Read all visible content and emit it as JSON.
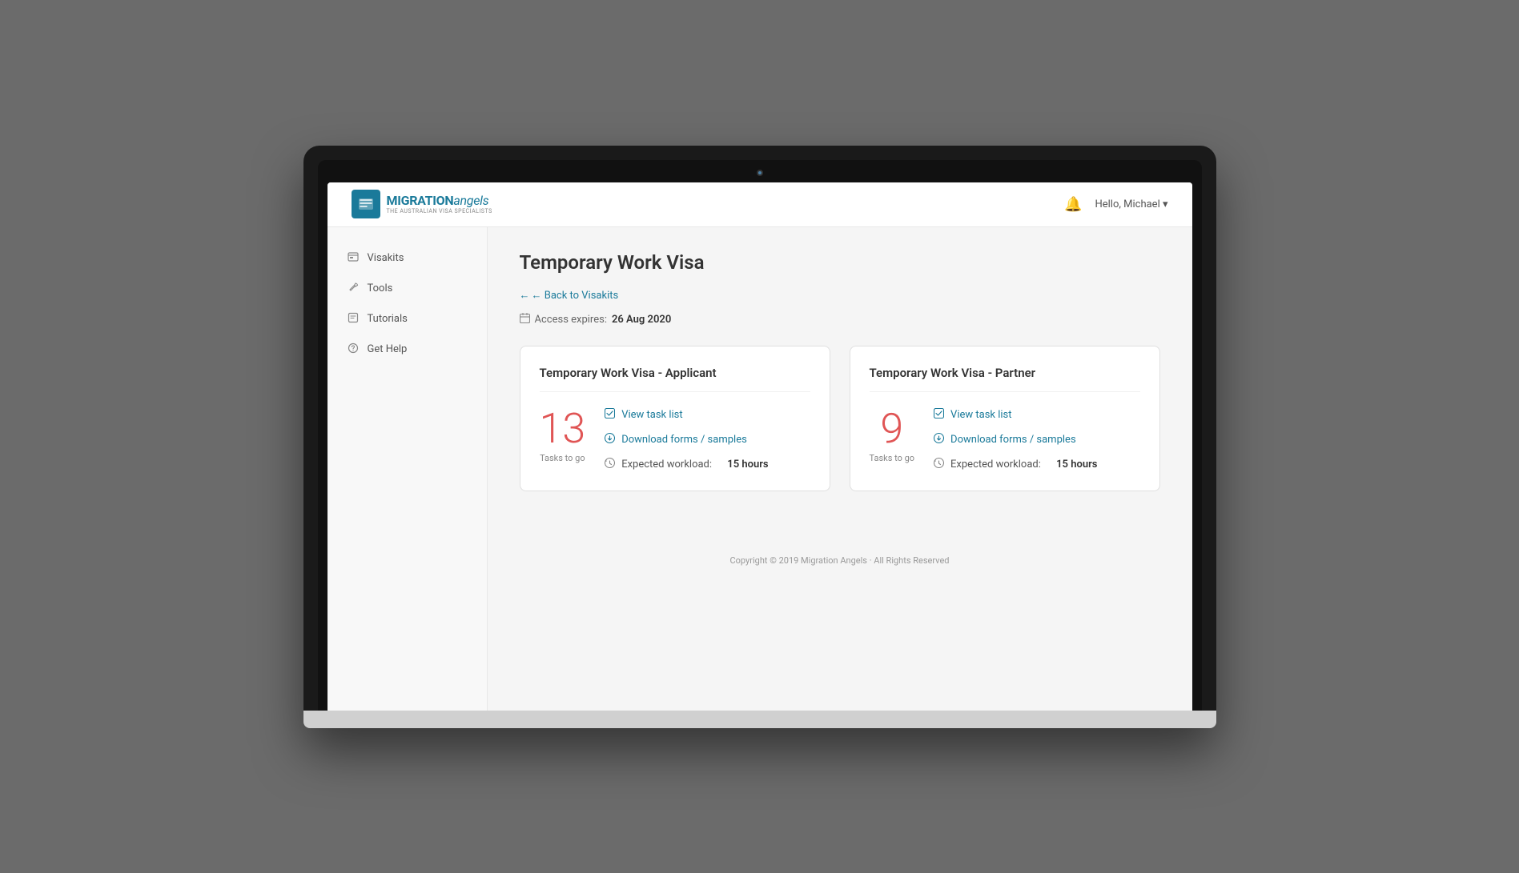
{
  "header": {
    "logo_main": "MIGRATION",
    "logo_accent": "angels",
    "logo_subtitle": "THE AUSTRALIAN VISA SPECIALISTS",
    "greeting": "Hello, Michael ▾"
  },
  "sidebar": {
    "items": [
      {
        "id": "visakits",
        "label": "Visakits",
        "icon": "🪪"
      },
      {
        "id": "tools",
        "label": "Tools",
        "icon": "🔑"
      },
      {
        "id": "tutorials",
        "label": "Tutorials",
        "icon": "📋"
      },
      {
        "id": "gethelp",
        "label": "Get Help",
        "icon": "❓"
      }
    ]
  },
  "main": {
    "page_title": "Temporary Work Visa",
    "back_link": "← Back to Visakits",
    "access_expires_label": "Access expires:",
    "access_expires_date": "26 Aug 2020",
    "applicant_card": {
      "title": "Temporary Work Visa - Applicant",
      "tasks_count": "13",
      "tasks_label": "Tasks to go",
      "view_task_list": "View task list",
      "download_forms": "Download forms / samples",
      "workload_label": "Expected workload:",
      "workload_value": "15 hours"
    },
    "partner_card": {
      "title": "Temporary Work Visa - Partner",
      "tasks_count": "9",
      "tasks_label": "Tasks to go",
      "view_task_list": "View task list",
      "download_forms": "Download forms / samples",
      "workload_label": "Expected workload:",
      "workload_value": "15 hours"
    }
  },
  "footer": {
    "text": "Copyright © 2019 Migration Angels · All Rights Reserved"
  }
}
